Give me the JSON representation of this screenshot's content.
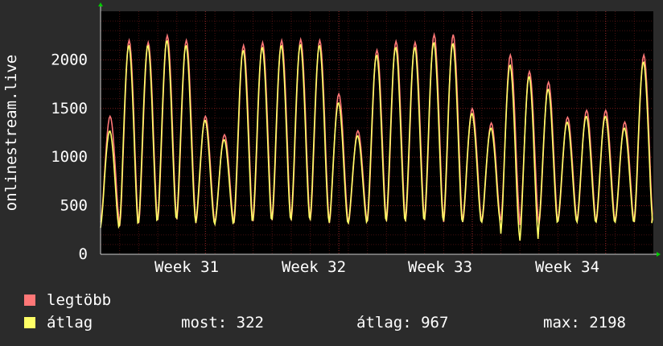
{
  "chart_data": {
    "type": "line",
    "ylabel": "onlinestream.live",
    "ylim": [
      0,
      2500
    ],
    "yticks": [
      0,
      500,
      1000,
      1500,
      2000
    ],
    "xtick_labels": [
      "Week 31",
      "Week 32",
      "Week 33",
      "Week 34"
    ],
    "grid": true,
    "colors": {
      "legtobb": "#ff7777",
      "atlag": "#ffff66",
      "grid": "#8a2020",
      "axis": "#cccccc",
      "arrow": "#00cc00"
    },
    "series": [
      {
        "name": "legtöbb",
        "daily_peaks": [
          1420,
          2200,
          2180,
          2250,
          2200,
          1420,
          1230,
          2150,
          2180,
          2200,
          2210,
          2200,
          1650,
          1270,
          2100,
          2190,
          2180,
          2260,
          2260,
          1500,
          1350,
          2050,
          1880,
          1770,
          1410,
          1480,
          1480,
          1360,
          2050
        ],
        "daily_troughs": [
          330,
          290,
          320,
          350,
          360,
          320,
          320,
          320,
          340,
          350,
          350,
          350,
          320,
          320,
          340,
          340,
          340,
          350,
          330,
          330,
          330,
          350,
          300,
          310,
          340,
          330,
          330,
          330,
          330
        ]
      },
      {
        "name": "átlag",
        "daily_peaks": [
          1270,
          2150,
          2150,
          2200,
          2150,
          1380,
          1180,
          2100,
          2130,
          2150,
          2160,
          2150,
          1560,
          1220,
          2050,
          2130,
          2130,
          2180,
          2170,
          1450,
          1300,
          1950,
          1830,
          1700,
          1360,
          1420,
          1420,
          1300,
          1980
        ],
        "daily_troughs": [
          260,
          280,
          310,
          340,
          350,
          310,
          300,
          310,
          330,
          340,
          340,
          340,
          310,
          310,
          330,
          330,
          330,
          340,
          320,
          320,
          320,
          190,
          120,
          300,
          330,
          320,
          320,
          320,
          320
        ]
      }
    ]
  },
  "legend": {
    "items": [
      {
        "label": "legtöbb",
        "color": "#ff7777"
      },
      {
        "label": "átlag",
        "color": "#ffff66"
      }
    ]
  },
  "stats": {
    "most": "most: 322",
    "atlag": "átlag: 967",
    "max": "max: 2198"
  }
}
